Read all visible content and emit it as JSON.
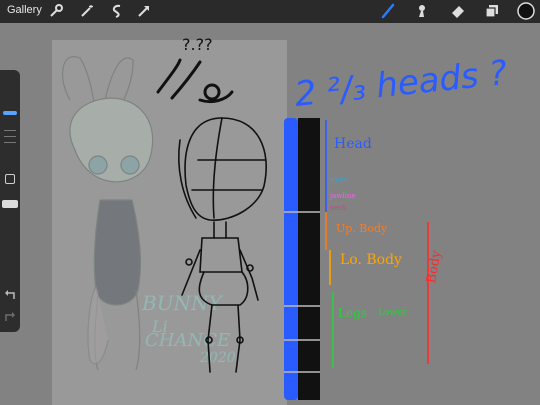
{
  "toolbar": {
    "gallery_label": "Gallery",
    "left_tools": [
      "wrench-icon",
      "magic-wand-icon",
      "selection-icon",
      "transform-arrow-icon"
    ],
    "right_tools": [
      "brush-icon",
      "smudge-icon",
      "eraser-icon",
      "layers-icon",
      "color-swatch"
    ],
    "active_color": "#111111",
    "brush_accent": "#2a7cff"
  },
  "sidebar": {
    "controls": [
      "brush-size-slider",
      "modify-button",
      "brush-opacity-slider",
      "undo-icon",
      "redo-icon"
    ]
  },
  "canvas": {
    "scribble": "?.??",
    "headline": "2 ²/₃ heads ?",
    "proportions": {
      "head": "Head",
      "eyes": "eyes",
      "jaw": "jawline",
      "neck": "neck",
      "up_body": "Up. Body",
      "lo_body": "Lo. Body",
      "legs": "Legs",
      "legs_extra": "Lower",
      "body": "Body"
    },
    "character_text": [
      "BUNNY",
      "Li",
      "CHANCE",
      "2020"
    ]
  },
  "colors": {
    "blue_ruler": "#2a5bff",
    "head_line": "#2a5bff",
    "eyes": "#2aa7e0",
    "jaw": "#ff55ff",
    "neck": "#ff2a8a",
    "up_body": "#ff7a1a",
    "lo_body": "#ffa500",
    "legs": "#2ecc40",
    "body": "#ff2a2a"
  }
}
